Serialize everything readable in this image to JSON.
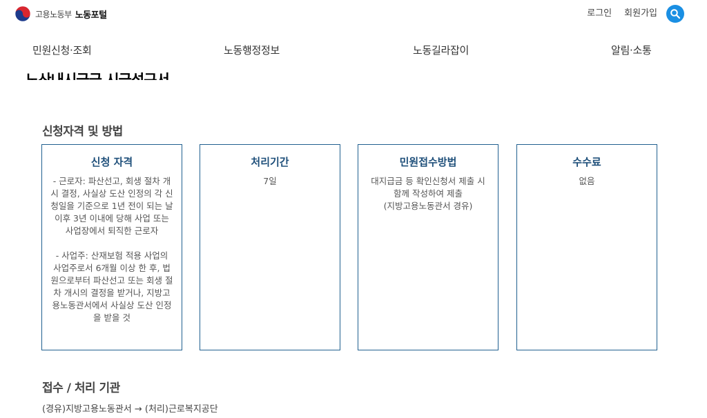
{
  "header": {
    "logo_ministry": "고용노동부",
    "logo_portal": "노동포털",
    "links": [
      "로그인",
      "회원가입"
    ]
  },
  "nav": [
    "민원신청·조회",
    "노동행정정보",
    "노동길라잡이",
    "알림·소통"
  ],
  "page_title": "노산내시급금 시급성구서",
  "section1_title": "신청자격 및 방법",
  "cards": [
    {
      "title": "신청 자격",
      "body": [
        "- 근로자: 파산선고, 회생 절차 개시 결정, 사실상 도산 인정의 각 신청일을 기준으로 1년 전이 되는 날 이후 3년 이내에 당해 사업 또는 사업장에서 퇴직한 근로자",
        "- 사업주: 산재보험 적용 사업의 사업주로서 6개월 이상 한 후, 법원으로부터 파산선고 또는 회생 절차 개시의 결정을 받거나, 지방고용노동관서에서 사실상 도산 인정을 받을 것"
      ]
    },
    {
      "title": "처리기간",
      "body": [
        "7일"
      ]
    },
    {
      "title": "민원접수방법",
      "body": [
        "대지급금 등 확인신청서 제출 시 함께 작성하여 제출",
        "(지방고용노동관서 경유)"
      ]
    },
    {
      "title": "수수료",
      "body": [
        "없음"
      ]
    }
  ],
  "section2_title": "접수 / 처리 기관",
  "route_text": "(경유)지방고용노동관서 → (처리)근로복지공단",
  "colors": {
    "accent_blue": "#1a8fe3",
    "card_border": "#1f5f8f",
    "card_title": "#1e4f7a"
  }
}
